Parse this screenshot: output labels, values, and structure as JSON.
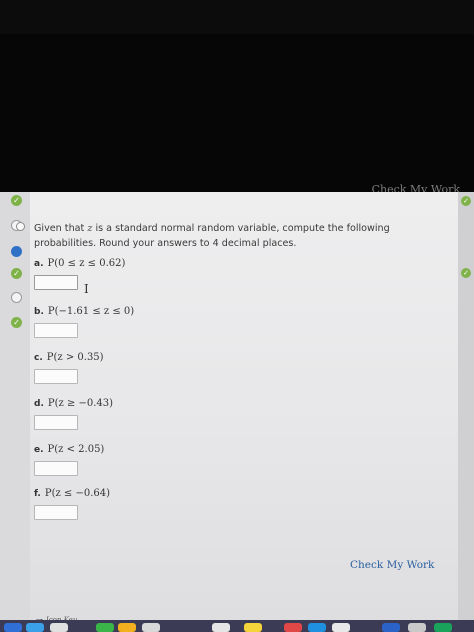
{
  "header": {
    "fragment": "Check My Work"
  },
  "question": {
    "intro_before": "Given that ",
    "variable": "z",
    "intro_after": " is a standard normal random variable, compute the following probabilities. Round your answers to 4 decimal places."
  },
  "parts": [
    {
      "letter": "a.",
      "expr": "P(0 ≤ z ≤ 0.62)",
      "value": ""
    },
    {
      "letter": "b.",
      "expr": "P(−1.61 ≤ z ≤ 0)",
      "value": ""
    },
    {
      "letter": "c.",
      "expr": "P(z > 0.35)",
      "value": ""
    },
    {
      "letter": "d.",
      "expr": "P(z ≥ −0.43)",
      "value": ""
    },
    {
      "letter": "e.",
      "expr": "P(z < 2.05)",
      "value": ""
    },
    {
      "letter": "f.",
      "expr": "P(z ≤ −0.64)",
      "value": ""
    }
  ],
  "check_my_work": "Check My Work",
  "icon_key": "Icon Key",
  "icons": {
    "rail": [
      "check-icon",
      "radio-icon",
      "current-question-icon",
      "check-icon",
      "radio-icon",
      "check-icon"
    ],
    "text_cursor": "I"
  },
  "colors": {
    "complete": "#7fb34a",
    "current": "#2f71c7",
    "link": "#2a5f9e"
  }
}
